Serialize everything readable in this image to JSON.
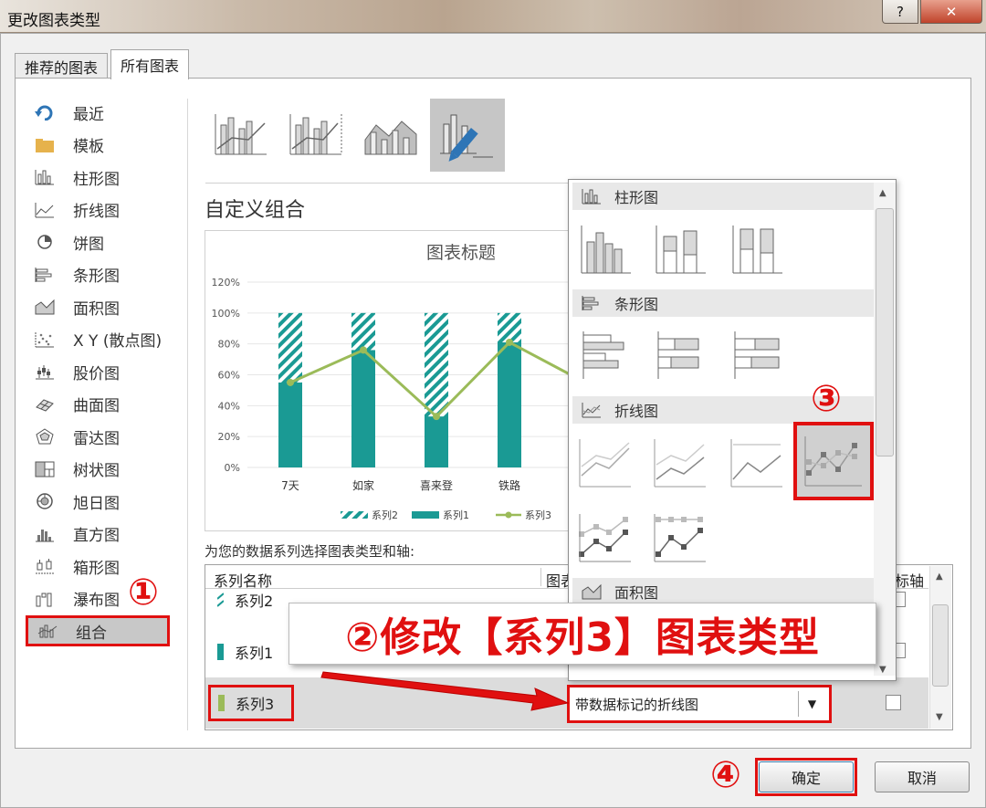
{
  "window": {
    "title": "更改图表类型",
    "help": "?",
    "close": "✕"
  },
  "tabs": [
    {
      "label": "推荐的图表"
    },
    {
      "label": "所有图表"
    }
  ],
  "nav": {
    "items": [
      {
        "label": "最近",
        "icon": "recent-icon"
      },
      {
        "label": "模板",
        "icon": "folder-icon"
      },
      {
        "label": "柱形图",
        "icon": "column-chart-icon"
      },
      {
        "label": "折线图",
        "icon": "line-chart-icon"
      },
      {
        "label": "饼图",
        "icon": "pie-chart-icon"
      },
      {
        "label": "条形图",
        "icon": "bar-chart-icon"
      },
      {
        "label": "面积图",
        "icon": "area-chart-icon"
      },
      {
        "label": "X Y (散点图)",
        "icon": "scatter-chart-icon"
      },
      {
        "label": "股价图",
        "icon": "stock-chart-icon"
      },
      {
        "label": "曲面图",
        "icon": "surface-chart-icon"
      },
      {
        "label": "雷达图",
        "icon": "radar-chart-icon"
      },
      {
        "label": "树状图",
        "icon": "treemap-icon"
      },
      {
        "label": "旭日图",
        "icon": "sunburst-icon"
      },
      {
        "label": "直方图",
        "icon": "histogram-icon"
      },
      {
        "label": "箱形图",
        "icon": "boxplot-icon"
      },
      {
        "label": "瀑布图",
        "icon": "waterfall-icon"
      },
      {
        "label": "组合",
        "icon": "combo-chart-icon",
        "selected": true
      }
    ]
  },
  "main": {
    "section_title": "自定义组合",
    "series_prompt": "为您的数据系列选择图表类型和轴:",
    "table": {
      "headers": {
        "name": "系列名称",
        "type": "图表",
        "axis": "标轴"
      },
      "rows": [
        {
          "name": "系列2",
          "color": "#1a9a94"
        },
        {
          "name": "系列1",
          "color": "#1a9a94"
        },
        {
          "name": "系列3",
          "color": "#9bbb59",
          "type_value": "带数据标记的折线图"
        }
      ]
    }
  },
  "gallery": {
    "sections": [
      {
        "label": "柱形图"
      },
      {
        "label": "条形图"
      },
      {
        "label": "折线图"
      },
      {
        "label": "面积图"
      }
    ]
  },
  "annotations": {
    "step1": "①",
    "step2_text": "②修改【系列3】图表类型",
    "step3": "③",
    "step4": "④"
  },
  "buttons": {
    "ok": "确定",
    "cancel": "取消"
  },
  "chart_data": {
    "type": "bar",
    "title": "图表标题",
    "categories": [
      "7天",
      "如家",
      "喜来登",
      "铁路"
    ],
    "ylim": [
      0,
      120
    ],
    "yticks": [
      "0%",
      "20%",
      "40%",
      "60%",
      "80%",
      "100%",
      "120%"
    ],
    "series": [
      {
        "name": "系列2",
        "values": [
          100,
          100,
          100,
          100
        ],
        "style": "hatched",
        "color": "#1a9a94"
      },
      {
        "name": "系列1",
        "values": [
          55,
          76,
          33,
          81
        ],
        "style": "solid",
        "color": "#1a9a94"
      },
      {
        "name": "系列3",
        "values": [
          55,
          76,
          33,
          81
        ],
        "style": "line-marker",
        "color": "#9bbb59"
      }
    ]
  }
}
